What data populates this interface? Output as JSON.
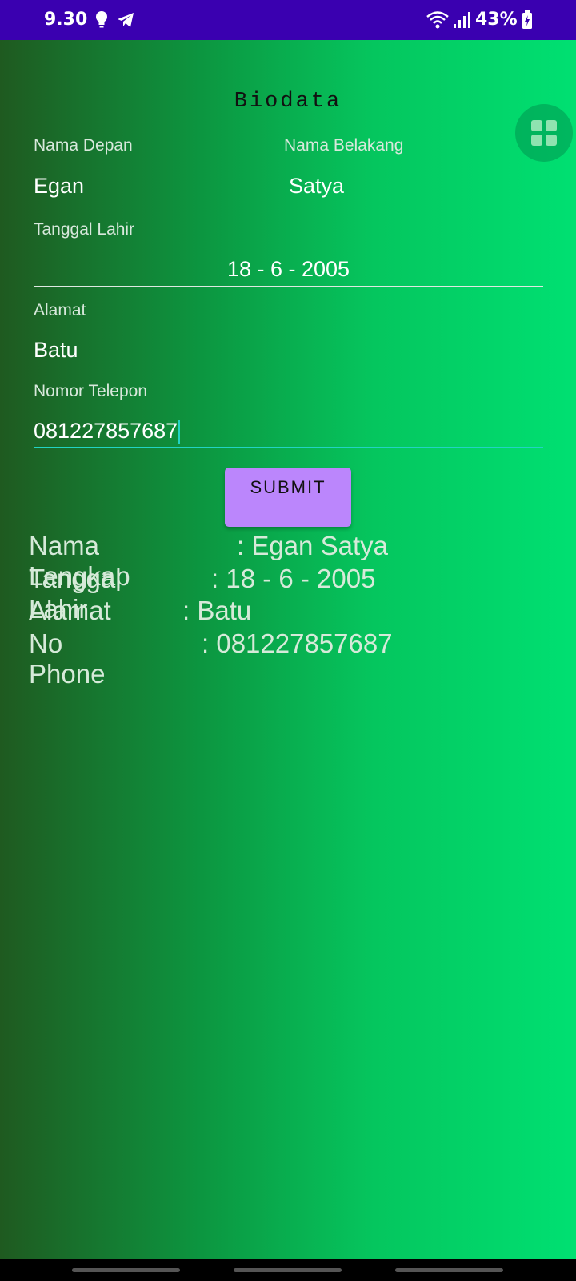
{
  "status_bar": {
    "time": "9.30",
    "battery_text": "43%",
    "icons": [
      "lightbulb-icon",
      "telegram-icon",
      "wifi-icon",
      "signal-icon",
      "battery-charging-icon"
    ]
  },
  "app": {
    "title": "Biodata",
    "fab_icon": "grid-icon",
    "colors": {
      "gradient_left": "#1f5a20",
      "gradient_right": "#00e072",
      "button": "#bb86fc",
      "focus_underline": "#22d3c3",
      "status_bar": "#3a00b0"
    }
  },
  "form": {
    "first_name": {
      "label": "Nama Depan",
      "value": "Egan"
    },
    "last_name": {
      "label": "Nama Belakang",
      "value": "Satya"
    },
    "birth_date": {
      "label": "Tanggal Lahir",
      "value": "18 - 6 - 2005"
    },
    "address": {
      "label": "Alamat",
      "value": "Batu"
    },
    "phone": {
      "label": "Nomor Telepon",
      "value": "081227857687"
    },
    "submit_label": "SUBMIT"
  },
  "output": [
    {
      "label": "Nama Lengkap",
      "value": ": Egan Satya"
    },
    {
      "label": "Tanggal Lahir",
      "value": ": 18 - 6 - 2005"
    },
    {
      "label": "Alamat",
      "value": ": Batu"
    },
    {
      "label": "No Phone",
      "value": ": 081227857687"
    }
  ]
}
